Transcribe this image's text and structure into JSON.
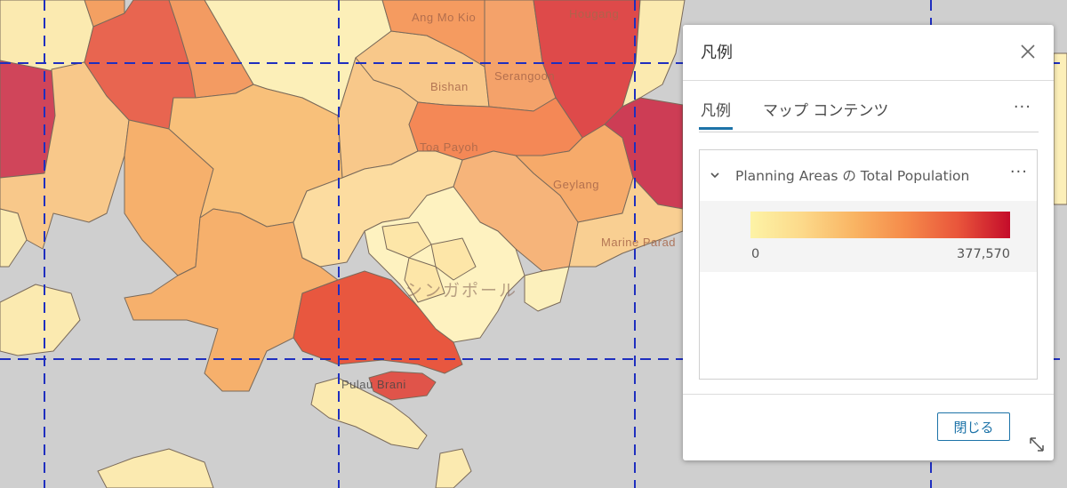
{
  "map": {
    "labels": {
      "ang_mo_kio": "Ang Mo Kio",
      "hougang": "Hougang",
      "bishan": "Bishan",
      "serangoon": "Serangoon",
      "toa_payoh": "Toa Payoh",
      "geylang": "Geylang",
      "marine_parade": "Marine Parad",
      "singapore": "シンガポール",
      "pulau_brani": "Pulau Brani"
    }
  },
  "panel": {
    "title": "凡例",
    "close_icon": "close-icon",
    "tabs": [
      {
        "label": "凡例",
        "active": true
      },
      {
        "label": "マップ コンテンツ",
        "active": false
      }
    ],
    "more_label": "···",
    "layer": {
      "title": "Planning Areas の Total Population",
      "more_label": "···",
      "ramp": {
        "min": "0",
        "max": "377,570",
        "colors": [
          "#fdf3a6",
          "#fcd98a",
          "#f9b463",
          "#f58a4a",
          "#e9553b",
          "#c40c2a"
        ]
      }
    },
    "close_button_label": "閉じる",
    "resize_icon": "resize-icon"
  },
  "colors": {
    "accent": "#1d73a8",
    "water": "#cfcfcf"
  }
}
